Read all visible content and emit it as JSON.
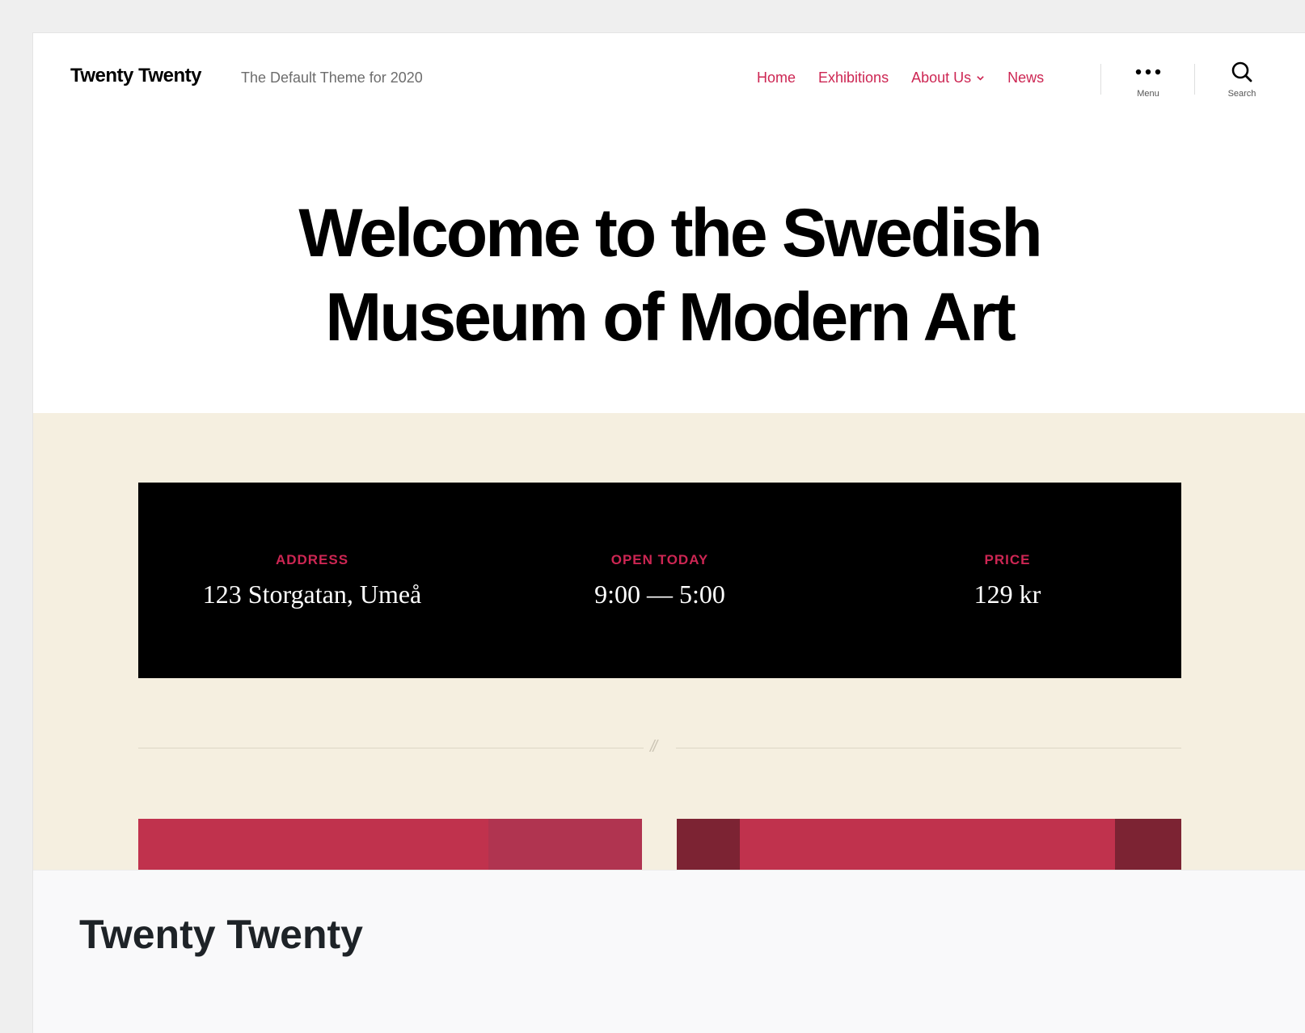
{
  "site": {
    "title": "Twenty Twenty",
    "tagline": "The Default Theme for 2020"
  },
  "nav": {
    "items": [
      {
        "label": "Home"
      },
      {
        "label": "Exhibitions"
      },
      {
        "label": "About Us",
        "has_dropdown": true
      },
      {
        "label": "News"
      }
    ],
    "menu_label": "Menu",
    "search_label": "Search",
    "menu_icon": "ellipsis-icon",
    "search_icon": "search-icon"
  },
  "hero": {
    "title": "Welcome to the Swedish Museum of Modern Art"
  },
  "info": [
    {
      "label": "ADDRESS",
      "value": "123 Storgatan, Umeå"
    },
    {
      "label": "OPEN TODAY",
      "value": "9:00 — 5:00"
    },
    {
      "label": "PRICE",
      "value": "129 kr"
    }
  ],
  "separator": {
    "glyph": "//"
  },
  "caption": {
    "title": "Twenty Twenty"
  },
  "colors": {
    "accent": "#cd2653",
    "band_background": "#f5efe0",
    "info_background": "#000000",
    "card_primary": "#c0324d",
    "card_dark": "#7c2333"
  }
}
